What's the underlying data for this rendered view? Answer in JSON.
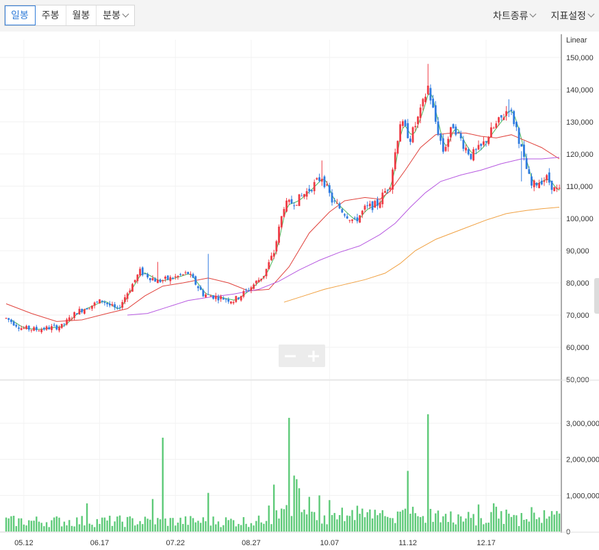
{
  "toolbar": {
    "periods": [
      "일봉",
      "주봉",
      "월봉",
      "분봉"
    ],
    "active_period": "일봉",
    "chart_type_label": "차트종류",
    "settings_label": "지표설정"
  },
  "colors": {
    "up": "#ef3a44",
    "down": "#2f7be0",
    "ma5": "#49b85a",
    "ma20": "#e0403a",
    "ma60": "#b657e0",
    "ma120": "#f0a040",
    "volume": "#5dca78"
  },
  "icons": [
    "minus-icon",
    "plus-icon",
    "chevron-down-icon"
  ],
  "chart_data": [
    {
      "type": "candlestick",
      "scale_label": "Linear",
      "y_ticks": [
        "150,000",
        "140,000",
        "130,000",
        "120,000",
        "110,000",
        "100,000",
        "90,000",
        "80,000",
        "70,000",
        "60,000",
        "50,000"
      ],
      "ylim": [
        50000,
        155500
      ],
      "grid": true,
      "x_ticks": [
        "05.12",
        "06.17",
        "07.22",
        "08.27",
        "10.07",
        "11.12",
        "12.17"
      ],
      "keyframes": [
        {
          "i": 0,
          "v": 69000
        },
        {
          "i": 6,
          "v": 66000
        },
        {
          "i": 12,
          "v": 65500
        },
        {
          "i": 22,
          "v": 66500
        },
        {
          "i": 28,
          "v": 71000
        },
        {
          "i": 38,
          "v": 74500
        },
        {
          "i": 44,
          "v": 71500
        },
        {
          "i": 48,
          "v": 77000
        },
        {
          "i": 53,
          "v": 83500
        },
        {
          "i": 60,
          "v": 80500
        },
        {
          "i": 66,
          "v": 81500
        },
        {
          "i": 72,
          "v": 83000
        },
        {
          "i": 78,
          "v": 76500
        },
        {
          "i": 84,
          "v": 75500
        },
        {
          "i": 90,
          "v": 74500
        },
        {
          "i": 96,
          "v": 78000
        },
        {
          "i": 102,
          "v": 82500
        },
        {
          "i": 106,
          "v": 89500
        },
        {
          "i": 110,
          "v": 104000
        },
        {
          "i": 115,
          "v": 105500
        },
        {
          "i": 120,
          "v": 109000
        },
        {
          "i": 125,
          "v": 113000
        },
        {
          "i": 129,
          "v": 105500
        },
        {
          "i": 135,
          "v": 101000
        },
        {
          "i": 138,
          "v": 99000
        },
        {
          "i": 142,
          "v": 103000
        },
        {
          "i": 147,
          "v": 104500
        },
        {
          "i": 152,
          "v": 111000
        },
        {
          "i": 156,
          "v": 130000
        },
        {
          "i": 160,
          "v": 125000
        },
        {
          "i": 164,
          "v": 133000
        },
        {
          "i": 167,
          "v": 141000
        },
        {
          "i": 170,
          "v": 130000
        },
        {
          "i": 173,
          "v": 121000
        },
        {
          "i": 177,
          "v": 129000
        },
        {
          "i": 181,
          "v": 123000
        },
        {
          "i": 184,
          "v": 119500
        },
        {
          "i": 188,
          "v": 122000
        },
        {
          "i": 192,
          "v": 127000
        },
        {
          "i": 196,
          "v": 131000
        },
        {
          "i": 199,
          "v": 134500
        },
        {
          "i": 202,
          "v": 128000
        },
        {
          "i": 205,
          "v": 118000
        },
        {
          "i": 208,
          "v": 110000
        },
        {
          "i": 211,
          "v": 111500
        },
        {
          "i": 214,
          "v": 112500
        },
        {
          "i": 217,
          "v": 109000
        },
        {
          "i": 219,
          "v": 108500
        }
      ],
      "spikes": [
        {
          "i": 30,
          "h": 72000
        },
        {
          "i": 60,
          "h": 86500
        },
        {
          "i": 80,
          "h": 89000
        },
        {
          "i": 167,
          "h": 148000
        },
        {
          "i": 199,
          "h": 137000
        },
        {
          "i": 125,
          "h": 118000
        },
        {
          "i": 204,
          "h": 111500
        }
      ],
      "ma_series": [
        {
          "key": "ma20",
          "start": 0,
          "points": [
            [
              0,
              73500
            ],
            [
              10,
              70500
            ],
            [
              20,
              68000
            ],
            [
              30,
              68500
            ],
            [
              40,
              70500
            ],
            [
              48,
              72000
            ],
            [
              55,
              76000
            ],
            [
              62,
              79000
            ],
            [
              70,
              80000
            ],
            [
              80,
              81500
            ],
            [
              88,
              80000
            ],
            [
              96,
              77500
            ],
            [
              104,
              78000
            ],
            [
              112,
              85000
            ],
            [
              120,
              95500
            ],
            [
              128,
              102000
            ],
            [
              134,
              105500
            ],
            [
              142,
              106500
            ],
            [
              148,
              106000
            ],
            [
              152,
              108500
            ],
            [
              158,
              115000
            ],
            [
              164,
              122000
            ],
            [
              170,
              126000
            ],
            [
              176,
              126500
            ],
            [
              182,
              126500
            ],
            [
              188,
              125500
            ],
            [
              194,
              125000
            ],
            [
              200,
              126000
            ],
            [
              206,
              124000
            ],
            [
              212,
              122000
            ],
            [
              219,
              118500
            ]
          ]
        },
        {
          "key": "ma60",
          "start": 48,
          "points": [
            [
              48,
              70000
            ],
            [
              56,
              70500
            ],
            [
              64,
              72500
            ],
            [
              72,
              74500
            ],
            [
              80,
              75500
            ],
            [
              90,
              76500
            ],
            [
              100,
              78000
            ],
            [
              108,
              80500
            ],
            [
              116,
              84000
            ],
            [
              124,
              87000
            ],
            [
              132,
              89500
            ],
            [
              140,
              91500
            ],
            [
              148,
              95000
            ],
            [
              154,
              98500
            ],
            [
              160,
              103500
            ],
            [
              166,
              108000
            ],
            [
              172,
              111500
            ],
            [
              180,
              113500
            ],
            [
              188,
              115000
            ],
            [
              196,
              117000
            ],
            [
              204,
              118500
            ],
            [
              212,
              118500
            ],
            [
              219,
              119000
            ]
          ]
        },
        {
          "key": "ma120",
          "start": 110,
          "points": [
            [
              110,
              74000
            ],
            [
              118,
              76000
            ],
            [
              126,
              78000
            ],
            [
              134,
              79500
            ],
            [
              142,
              81000
            ],
            [
              150,
              83000
            ],
            [
              156,
              86000
            ],
            [
              162,
              90000
            ],
            [
              170,
              93500
            ],
            [
              180,
              96500
            ],
            [
              190,
              99500
            ],
            [
              198,
              101500
            ],
            [
              206,
              102500
            ],
            [
              212,
              103000
            ],
            [
              219,
              103500
            ]
          ]
        }
      ],
      "volume": {
        "y_ticks": [
          "3,000,000",
          "2,000,000",
          "1,000,000",
          "0"
        ],
        "ylim": [
          0,
          4100000
        ],
        "peaks": [
          {
            "i": 62,
            "v": 2600000
          },
          {
            "i": 112,
            "v": 3150000
          },
          {
            "i": 114,
            "v": 1550000
          },
          {
            "i": 115,
            "v": 1450000
          },
          {
            "i": 116,
            "v": 1200000
          },
          {
            "i": 106,
            "v": 1300000
          },
          {
            "i": 159,
            "v": 1680000
          },
          {
            "i": 167,
            "v": 3250000
          },
          {
            "i": 32,
            "v": 780000
          },
          {
            "i": 80,
            "v": 1070000
          },
          {
            "i": 58,
            "v": 900000
          },
          {
            "i": 104,
            "v": 720000
          },
          {
            "i": 128,
            "v": 870000
          },
          {
            "i": 124,
            "v": 1000000
          },
          {
            "i": 120,
            "v": 960000
          }
        ]
      }
    }
  ]
}
